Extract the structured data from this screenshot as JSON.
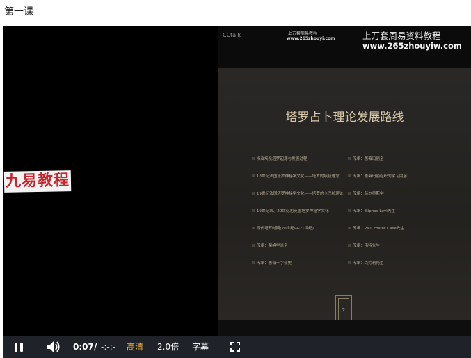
{
  "page": {
    "title": "第一课"
  },
  "video": {
    "left_watermark": "九易教程",
    "cctalk_label": "CCtalk",
    "small_watermark_title": "上万套周易教程",
    "small_watermark_url": "www.265zhouyi.com",
    "watermark_title": "上万套周易资料教程",
    "watermark_url": "www.265zhouyiw.com",
    "slide": {
      "title": "塔罗占卜理论发展路线",
      "left_rows": [
        "埃及埃及塔罗起源与发展过程",
        "18世纪法国塔罗神秘学文化——塔罗的埃及理念",
        "19世纪法国塔罗神秘学文化——塔罗的卡巴拉理论",
        "19世纪末、20世纪初英国塔罗神秘学文化",
        "现代塔罗时期(20世纪中-21世纪)",
        "传承：荣格学派全",
        "传承：蔷薇十字会史"
      ],
      "right_rows": [
        "传承：蔷薇玛丽全",
        "传承：蔷薇玛丽组织的学习内容",
        "传承：赫尔墨斯学",
        "传承：Eliphas Levi先生",
        "传承：Paul Foster Case先生",
        "传承：韦特先生",
        "传承：克劳利先生"
      ],
      "page_number": "2"
    }
  },
  "controls": {
    "current_time": "0:07",
    "separator": "/",
    "duration": "-:-:-",
    "quality": "高清",
    "speed": "2.0倍",
    "subtitle": "字幕",
    "play_state": "pause-icon",
    "volume_icon": "volume-icon",
    "fullscreen_icon": "fullscreen-icon"
  }
}
